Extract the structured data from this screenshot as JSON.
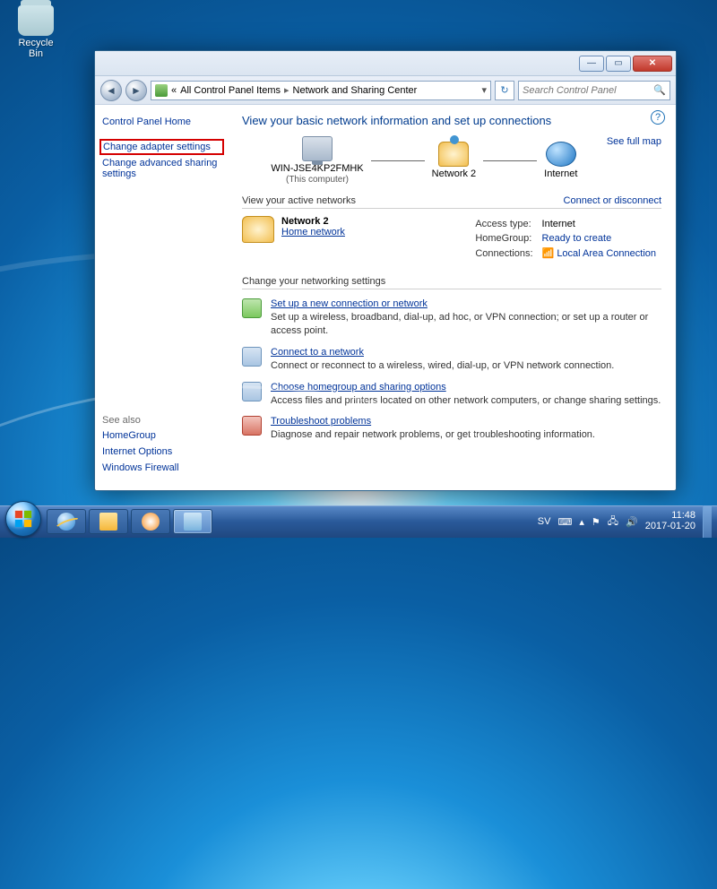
{
  "desktop": {
    "recycle_bin": "Recycle Bin"
  },
  "window_controls": {
    "min": "—",
    "max": "▭",
    "close": "✕"
  },
  "address": {
    "back": "◄",
    "fwd": "►",
    "crumb1": "All Control Panel Items",
    "crumb2": "Network and Sharing Center",
    "refresh": "↻"
  },
  "search": {
    "placeholder": "Search Control Panel"
  },
  "sidebar": {
    "home": "Control Panel Home",
    "adapter": "Change adapter settings",
    "advanced": "Change advanced sharing settings",
    "seealso_hdr": "See also",
    "seealso": [
      "HomeGroup",
      "Internet Options",
      "Windows Firewall"
    ]
  },
  "main": {
    "heading": "View your basic network information and set up connections",
    "see_full_map": "See full map",
    "map": {
      "pc_name": "WIN-JSE4KP2FMHK",
      "pc_sub": "(This computer)",
      "mid_name": "Network  2",
      "internet": "Internet"
    },
    "active_hdr": "View your active networks",
    "connect_disconnect": "Connect or disconnect",
    "active": {
      "name": "Network  2",
      "kind": "Home network",
      "access_lbl": "Access type:",
      "access_val": "Internet",
      "hg_lbl": "HomeGroup:",
      "hg_val": "Ready to create",
      "conn_lbl": "Connections:",
      "conn_val": "Local Area Connection"
    },
    "change_hdr": "Change your networking settings",
    "settings": [
      {
        "title": "Set up a new connection or network",
        "desc": "Set up a wireless, broadband, dial-up, ad hoc, or VPN connection; or set up a router or access point."
      },
      {
        "title": "Connect to a network",
        "desc": "Connect or reconnect to a wireless, wired, dial-up, or VPN network connection."
      },
      {
        "title": "Choose homegroup and sharing options",
        "desc": "Access files and printers located on other network computers, or change sharing settings."
      },
      {
        "title": "Troubleshoot problems",
        "desc": "Diagnose and repair network problems, or get troubleshooting information."
      }
    ]
  },
  "tray": {
    "lang": "SV",
    "time": "11:48",
    "date": "2017-01-20"
  }
}
